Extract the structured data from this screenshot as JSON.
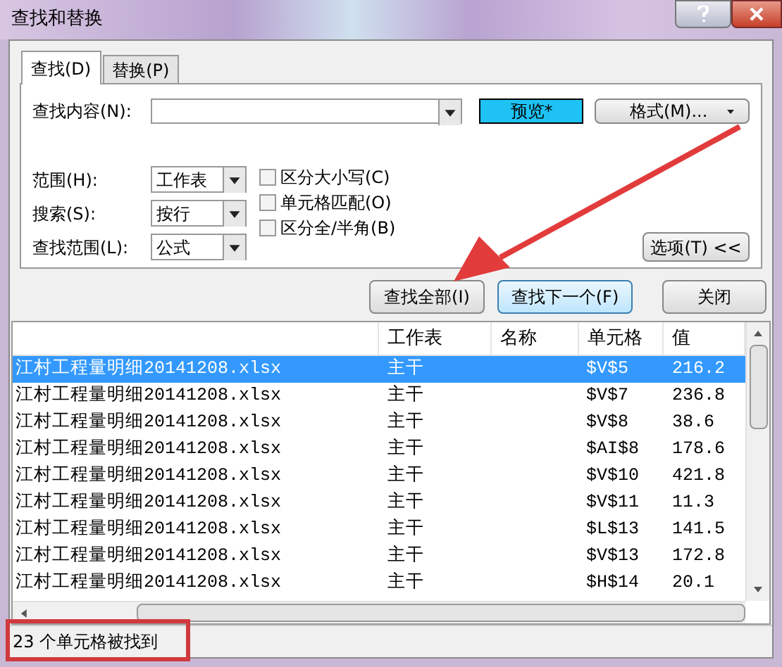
{
  "window": {
    "title": "查找和替换"
  },
  "tabs": [
    {
      "label": "查找(D)",
      "selected": true
    },
    {
      "label": "替换(P)",
      "selected": false
    }
  ],
  "find": {
    "label": "查找内容(N):",
    "preview": "预览*",
    "format_button": "格式(M)..."
  },
  "options": [
    {
      "label": "范围(H):",
      "value": "工作表"
    },
    {
      "label": "搜索(S):",
      "value": "按行"
    },
    {
      "label": "查找范围(L):",
      "value": "公式"
    }
  ],
  "checkboxes": [
    {
      "label": "区分大小写(C)",
      "checked": false
    },
    {
      "label": "单元格匹配(O)",
      "checked": false
    },
    {
      "label": "区分全/半角(B)",
      "checked": false
    }
  ],
  "options_button": "选项(T) <<",
  "buttons": [
    {
      "label": "查找全部(I)",
      "focused": false
    },
    {
      "label": "查找下一个(F)",
      "focused": true
    },
    {
      "label": "关闭",
      "focused": false
    }
  ],
  "results": {
    "columns": [
      "工作表",
      "名称",
      "单元格",
      "值"
    ],
    "rows": [
      {
        "file": "江村工程量明细20141208.xlsx",
        "sheet": "主干",
        "cell": "$V$5",
        "value": "216.2",
        "selected": true
      },
      {
        "file": "江村工程量明细20141208.xlsx",
        "sheet": "主干",
        "cell": "$V$7",
        "value": "236.8",
        "selected": false
      },
      {
        "file": "江村工程量明细20141208.xlsx",
        "sheet": "主干",
        "cell": "$V$8",
        "value": "38.6",
        "selected": false
      },
      {
        "file": "江村工程量明细20141208.xlsx",
        "sheet": "主干",
        "cell": "$AI$8",
        "value": "178.6",
        "selected": false
      },
      {
        "file": "江村工程量明细20141208.xlsx",
        "sheet": "主干",
        "cell": "$V$10",
        "value": "421.8",
        "selected": false
      },
      {
        "file": "江村工程量明细20141208.xlsx",
        "sheet": "主干",
        "cell": "$V$11",
        "value": "11.3",
        "selected": false
      },
      {
        "file": "江村工程量明细20141208.xlsx",
        "sheet": "主干",
        "cell": "$L$13",
        "value": "141.5",
        "selected": false
      },
      {
        "file": "江村工程量明细20141208.xlsx",
        "sheet": "主干",
        "cell": "$V$13",
        "value": "172.8",
        "selected": false
      },
      {
        "file": "江村工程量明细20141208.xlsx",
        "sheet": "主干",
        "cell": "$H$14",
        "value": "20.1",
        "selected": false
      }
    ]
  },
  "status_bar": "23 个单元格被找到"
}
